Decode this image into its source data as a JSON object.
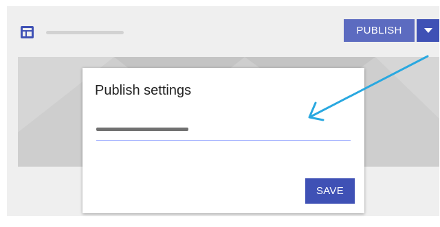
{
  "toolbar": {
    "layout_icon": "dashboard-layout-icon",
    "publish_label": "PUBLISH",
    "dropdown_icon": "arrow-drop-down-icon"
  },
  "dialog": {
    "title": "Publish settings",
    "save_label": "SAVE"
  },
  "annotation": {
    "arrow_icon": "callout-arrow-icon",
    "arrow_color": "#29a8e0"
  },
  "colors": {
    "primary": "#3f51b5",
    "primary_light": "#5c6bc0",
    "canvas": "#efefef",
    "preview": "#cecece",
    "field_underline": "#8c9eff"
  }
}
